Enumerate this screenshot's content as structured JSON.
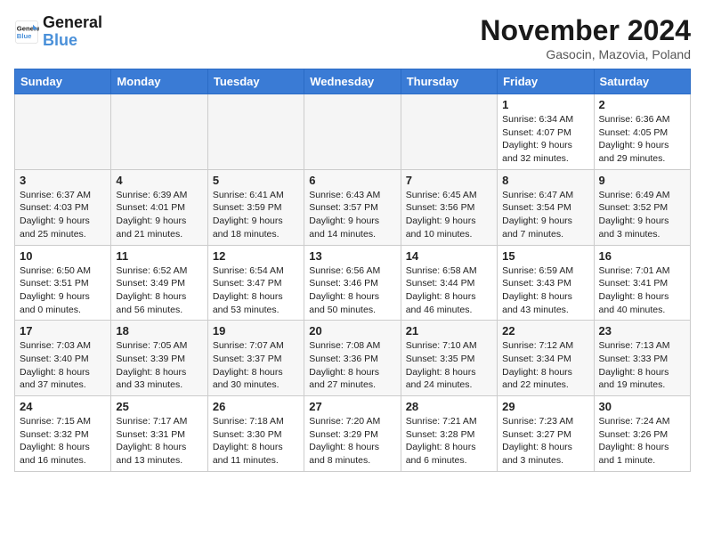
{
  "logo": {
    "line1": "General",
    "line2": "Blue"
  },
  "title": "November 2024",
  "subtitle": "Gasocin, Mazovia, Poland",
  "days_of_week": [
    "Sunday",
    "Monday",
    "Tuesday",
    "Wednesday",
    "Thursday",
    "Friday",
    "Saturday"
  ],
  "weeks": [
    [
      {
        "day": "",
        "detail": "",
        "empty": true
      },
      {
        "day": "",
        "detail": "",
        "empty": true
      },
      {
        "day": "",
        "detail": "",
        "empty": true
      },
      {
        "day": "",
        "detail": "",
        "empty": true
      },
      {
        "day": "",
        "detail": "",
        "empty": true
      },
      {
        "day": "1",
        "detail": "Sunrise: 6:34 AM\nSunset: 4:07 PM\nDaylight: 9 hours\nand 32 minutes."
      },
      {
        "day": "2",
        "detail": "Sunrise: 6:36 AM\nSunset: 4:05 PM\nDaylight: 9 hours\nand 29 minutes."
      }
    ],
    [
      {
        "day": "3",
        "detail": "Sunrise: 6:37 AM\nSunset: 4:03 PM\nDaylight: 9 hours\nand 25 minutes."
      },
      {
        "day": "4",
        "detail": "Sunrise: 6:39 AM\nSunset: 4:01 PM\nDaylight: 9 hours\nand 21 minutes."
      },
      {
        "day": "5",
        "detail": "Sunrise: 6:41 AM\nSunset: 3:59 PM\nDaylight: 9 hours\nand 18 minutes."
      },
      {
        "day": "6",
        "detail": "Sunrise: 6:43 AM\nSunset: 3:57 PM\nDaylight: 9 hours\nand 14 minutes."
      },
      {
        "day": "7",
        "detail": "Sunrise: 6:45 AM\nSunset: 3:56 PM\nDaylight: 9 hours\nand 10 minutes."
      },
      {
        "day": "8",
        "detail": "Sunrise: 6:47 AM\nSunset: 3:54 PM\nDaylight: 9 hours\nand 7 minutes."
      },
      {
        "day": "9",
        "detail": "Sunrise: 6:49 AM\nSunset: 3:52 PM\nDaylight: 9 hours\nand 3 minutes."
      }
    ],
    [
      {
        "day": "10",
        "detail": "Sunrise: 6:50 AM\nSunset: 3:51 PM\nDaylight: 9 hours\nand 0 minutes."
      },
      {
        "day": "11",
        "detail": "Sunrise: 6:52 AM\nSunset: 3:49 PM\nDaylight: 8 hours\nand 56 minutes."
      },
      {
        "day": "12",
        "detail": "Sunrise: 6:54 AM\nSunset: 3:47 PM\nDaylight: 8 hours\nand 53 minutes."
      },
      {
        "day": "13",
        "detail": "Sunrise: 6:56 AM\nSunset: 3:46 PM\nDaylight: 8 hours\nand 50 minutes."
      },
      {
        "day": "14",
        "detail": "Sunrise: 6:58 AM\nSunset: 3:44 PM\nDaylight: 8 hours\nand 46 minutes."
      },
      {
        "day": "15",
        "detail": "Sunrise: 6:59 AM\nSunset: 3:43 PM\nDaylight: 8 hours\nand 43 minutes."
      },
      {
        "day": "16",
        "detail": "Sunrise: 7:01 AM\nSunset: 3:41 PM\nDaylight: 8 hours\nand 40 minutes."
      }
    ],
    [
      {
        "day": "17",
        "detail": "Sunrise: 7:03 AM\nSunset: 3:40 PM\nDaylight: 8 hours\nand 37 minutes."
      },
      {
        "day": "18",
        "detail": "Sunrise: 7:05 AM\nSunset: 3:39 PM\nDaylight: 8 hours\nand 33 minutes."
      },
      {
        "day": "19",
        "detail": "Sunrise: 7:07 AM\nSunset: 3:37 PM\nDaylight: 8 hours\nand 30 minutes."
      },
      {
        "day": "20",
        "detail": "Sunrise: 7:08 AM\nSunset: 3:36 PM\nDaylight: 8 hours\nand 27 minutes."
      },
      {
        "day": "21",
        "detail": "Sunrise: 7:10 AM\nSunset: 3:35 PM\nDaylight: 8 hours\nand 24 minutes."
      },
      {
        "day": "22",
        "detail": "Sunrise: 7:12 AM\nSunset: 3:34 PM\nDaylight: 8 hours\nand 22 minutes."
      },
      {
        "day": "23",
        "detail": "Sunrise: 7:13 AM\nSunset: 3:33 PM\nDaylight: 8 hours\nand 19 minutes."
      }
    ],
    [
      {
        "day": "24",
        "detail": "Sunrise: 7:15 AM\nSunset: 3:32 PM\nDaylight: 8 hours\nand 16 minutes."
      },
      {
        "day": "25",
        "detail": "Sunrise: 7:17 AM\nSunset: 3:31 PM\nDaylight: 8 hours\nand 13 minutes."
      },
      {
        "day": "26",
        "detail": "Sunrise: 7:18 AM\nSunset: 3:30 PM\nDaylight: 8 hours\nand 11 minutes."
      },
      {
        "day": "27",
        "detail": "Sunrise: 7:20 AM\nSunset: 3:29 PM\nDaylight: 8 hours\nand 8 minutes."
      },
      {
        "day": "28",
        "detail": "Sunrise: 7:21 AM\nSunset: 3:28 PM\nDaylight: 8 hours\nand 6 minutes."
      },
      {
        "day": "29",
        "detail": "Sunrise: 7:23 AM\nSunset: 3:27 PM\nDaylight: 8 hours\nand 3 minutes."
      },
      {
        "day": "30",
        "detail": "Sunrise: 7:24 AM\nSunset: 3:26 PM\nDaylight: 8 hours\nand 1 minute."
      }
    ]
  ]
}
